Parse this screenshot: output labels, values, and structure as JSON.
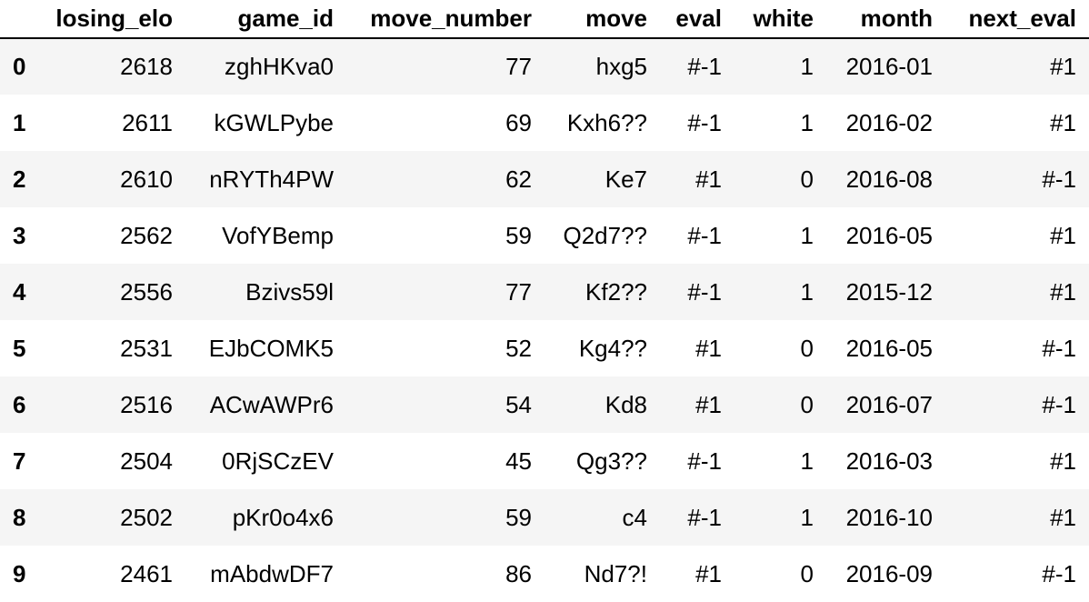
{
  "table": {
    "index_header": "",
    "columns": [
      "losing_elo",
      "game_id",
      "move_number",
      "move",
      "eval",
      "white",
      "month",
      "next_eval"
    ],
    "rows": [
      {
        "index": "0",
        "cells": [
          "2618",
          "zghHKva0",
          "77",
          "hxg5",
          "#-1",
          "1",
          "2016-01",
          "#1"
        ]
      },
      {
        "index": "1",
        "cells": [
          "2611",
          "kGWLPybe",
          "69",
          "Kxh6??",
          "#-1",
          "1",
          "2016-02",
          "#1"
        ]
      },
      {
        "index": "2",
        "cells": [
          "2610",
          "nRYTh4PW",
          "62",
          "Ke7",
          "#1",
          "0",
          "2016-08",
          "#-1"
        ]
      },
      {
        "index": "3",
        "cells": [
          "2562",
          "VofYBemp",
          "59",
          "Q2d7??",
          "#-1",
          "1",
          "2016-05",
          "#1"
        ]
      },
      {
        "index": "4",
        "cells": [
          "2556",
          "Bzivs59l",
          "77",
          "Kf2??",
          "#-1",
          "1",
          "2015-12",
          "#1"
        ]
      },
      {
        "index": "5",
        "cells": [
          "2531",
          "EJbCOMK5",
          "52",
          "Kg4??",
          "#1",
          "0",
          "2016-05",
          "#-1"
        ]
      },
      {
        "index": "6",
        "cells": [
          "2516",
          "ACwAWPr6",
          "54",
          "Kd8",
          "#1",
          "0",
          "2016-07",
          "#-1"
        ]
      },
      {
        "index": "7",
        "cells": [
          "2504",
          "0RjSCzEV",
          "45",
          "Qg3??",
          "#-1",
          "1",
          "2016-03",
          "#1"
        ]
      },
      {
        "index": "8",
        "cells": [
          "2502",
          "pKr0o4x6",
          "59",
          "c4",
          "#-1",
          "1",
          "2016-10",
          "#1"
        ]
      },
      {
        "index": "9",
        "cells": [
          "2461",
          "mAbdwDF7",
          "86",
          "Nd7?!",
          "#1",
          "0",
          "2016-09",
          "#-1"
        ]
      }
    ]
  },
  "colors": {
    "stripe": "#f5f5f5",
    "background": "#ffffff",
    "text": "#000000"
  }
}
